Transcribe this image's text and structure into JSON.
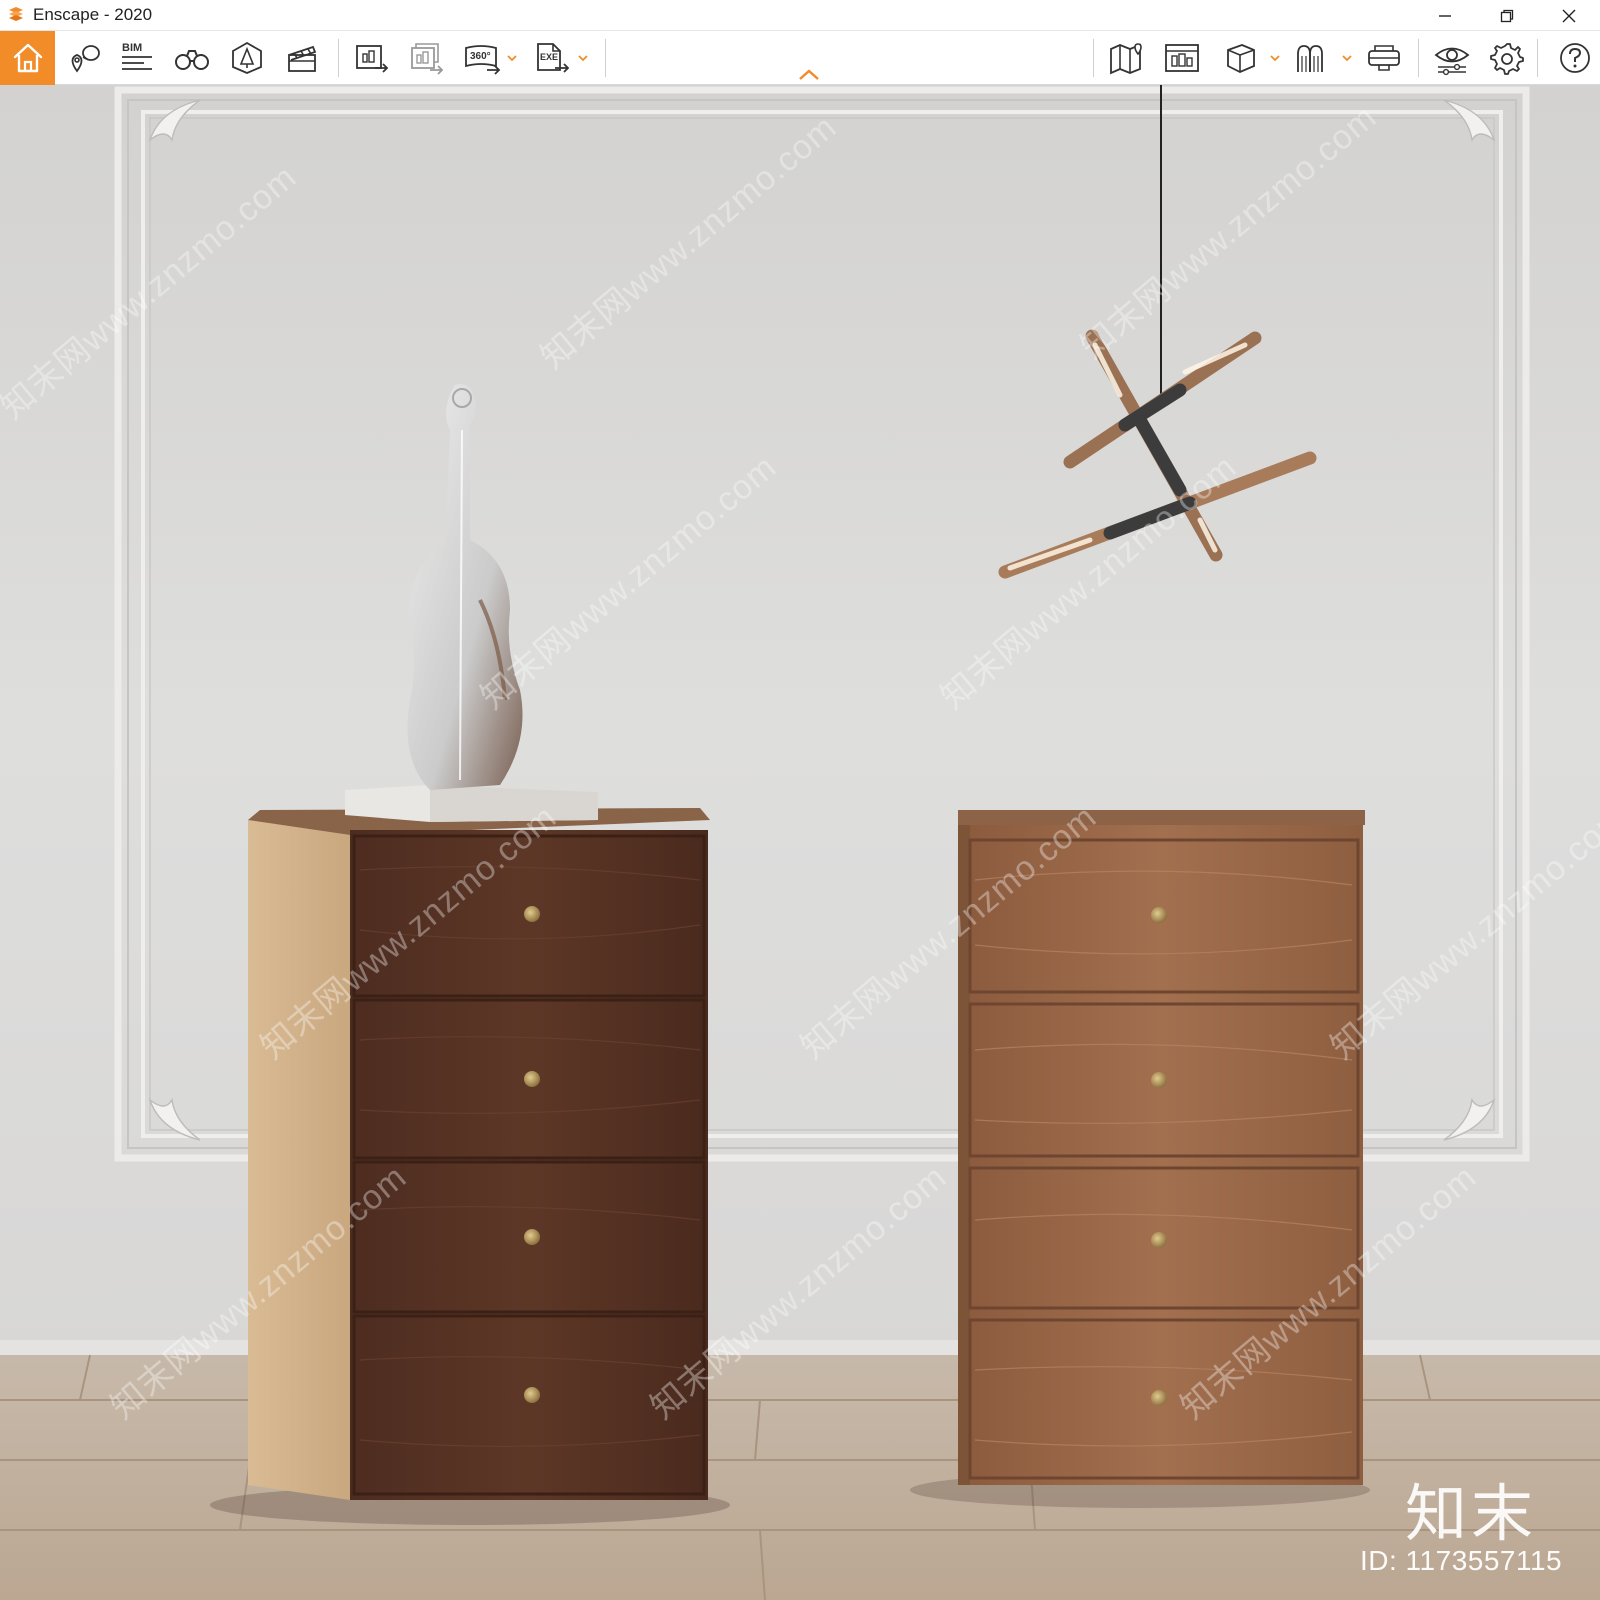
{
  "window": {
    "title": "Enscape - 2020",
    "accent_color": "#f28c28",
    "controls": [
      {
        "name": "minimize-icon"
      },
      {
        "name": "restore-icon"
      },
      {
        "name": "close-icon"
      }
    ]
  },
  "toolbar": {
    "left_group": [
      {
        "name": "home-button",
        "icon": "home-icon"
      },
      {
        "name": "views-button",
        "icon": "location-pin-icon"
      },
      {
        "name": "bim-button",
        "icon": "bim-list-icon",
        "label": "BIM"
      },
      {
        "name": "binoculars-button",
        "icon": "binoculars-icon"
      },
      {
        "name": "light-view-button",
        "icon": "light-view-icon"
      },
      {
        "name": "video-editor-button",
        "icon": "clapperboard-icon"
      }
    ],
    "export_group": [
      {
        "name": "screenshot-button",
        "icon": "render-export-icon"
      },
      {
        "name": "batch-render-button",
        "icon": "batch-render-icon"
      },
      {
        "name": "panorama-button",
        "icon": "panorama-icon",
        "label": "360°"
      },
      {
        "name": "export-exe-button",
        "icon": "export-exe-icon",
        "label": "EXE"
      }
    ],
    "right_group": [
      {
        "name": "map-button",
        "icon": "map-icon"
      },
      {
        "name": "asset-library-button",
        "icon": "asset-library-icon"
      },
      {
        "name": "material-editor-button",
        "icon": "cube-icon"
      },
      {
        "name": "upload-button",
        "icon": "upload-icon"
      },
      {
        "name": "vr-headset-button",
        "icon": "vr-headset-icon"
      }
    ],
    "settings_group": [
      {
        "name": "visual-settings-button",
        "icon": "eye-icon"
      },
      {
        "name": "general-settings-button",
        "icon": "gear-icon"
      },
      {
        "name": "help-button",
        "icon": "help-icon"
      }
    ]
  },
  "viewport": {
    "watermark_text": "知末网www.znzmo.com",
    "brand_mark": "知末",
    "brand_id": "ID: 1173557115",
    "colors": {
      "wall": "#dcdcdb",
      "floor": "#c8b8a6",
      "dark_wood": "#5a3527",
      "light_wood": "#9c6a4b",
      "side_wood": "#d7b890",
      "brass": "#b89858"
    }
  }
}
